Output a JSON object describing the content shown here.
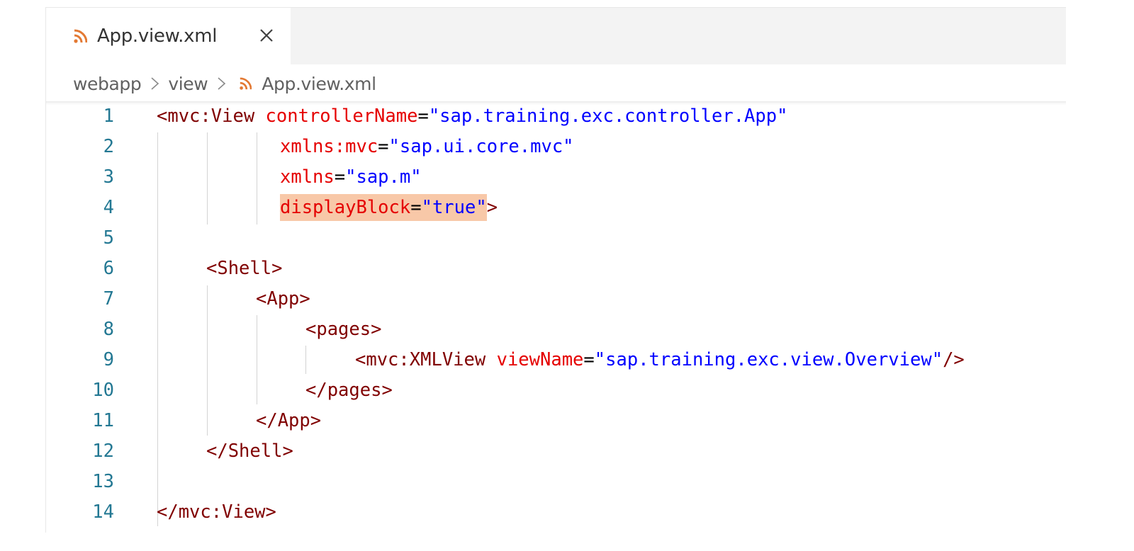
{
  "tab": {
    "label": "App.view.xml",
    "icon": "rss-icon",
    "close_icon": "close-icon"
  },
  "breadcrumb": {
    "items": [
      "webapp",
      "view",
      "App.view.xml"
    ]
  },
  "colors": {
    "tag": "#800000",
    "attribute": "#e50000",
    "string": "#0000ff",
    "line_number": "#237893",
    "highlight": "#f8c8a8",
    "file_icon": "#e37933"
  },
  "editor": {
    "line_numbers": [
      "1",
      "2",
      "3",
      "4",
      "5",
      "6",
      "7",
      "8",
      "9",
      "10",
      "11",
      "12",
      "13",
      "14"
    ],
    "lines": [
      {
        "tokens": [
          [
            "tag",
            "<mvc:View "
          ],
          [
            "attr",
            "controllerName"
          ],
          [
            "eq",
            "="
          ],
          [
            "str",
            "\"sap.training.exc.controller.App\""
          ]
        ]
      },
      {
        "tokens": [
          [
            "attr",
            "xmlns:mvc"
          ],
          [
            "eq",
            "="
          ],
          [
            "str",
            "\"sap.ui.core.mvc\""
          ]
        ]
      },
      {
        "tokens": [
          [
            "attr",
            "xmlns"
          ],
          [
            "eq",
            "="
          ],
          [
            "str",
            "\"sap.m\""
          ]
        ]
      },
      {
        "tokens": [
          [
            "attr",
            "displayBlock"
          ],
          [
            "eq",
            "="
          ],
          [
            "str",
            "\"true\""
          ],
          [
            "tag",
            ">"
          ]
        ],
        "highlight_tokens": 3
      },
      {
        "tokens": []
      },
      {
        "tokens": [
          [
            "tag",
            "<Shell>"
          ]
        ]
      },
      {
        "tokens": [
          [
            "tag",
            "<App>"
          ]
        ]
      },
      {
        "tokens": [
          [
            "tag",
            "<pages>"
          ]
        ]
      },
      {
        "tokens": [
          [
            "tag",
            "<mvc:XMLView "
          ],
          [
            "attr",
            "viewName"
          ],
          [
            "eq",
            "="
          ],
          [
            "str",
            "\"sap.training.exc.view.Overview\""
          ],
          [
            "tag",
            "/>"
          ]
        ]
      },
      {
        "tokens": [
          [
            "tag",
            "</pages>"
          ]
        ]
      },
      {
        "tokens": [
          [
            "tag",
            "</App>"
          ]
        ]
      },
      {
        "tokens": [
          [
            "tag",
            "</Shell>"
          ]
        ]
      },
      {
        "tokens": []
      },
      {
        "tokens": [
          [
            "tag",
            "</mvc:View>"
          ]
        ]
      }
    ]
  }
}
